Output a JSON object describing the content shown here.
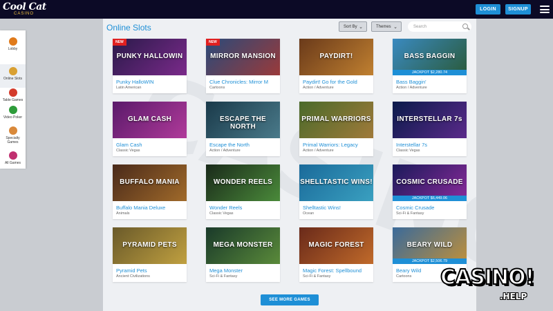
{
  "header": {
    "logo_text": "Cool Cat",
    "logo_sub": "CASINO",
    "login_label": "LOGIN",
    "signup_label": "SIGNUP"
  },
  "sidebar": {
    "items": [
      {
        "label": "Lobby",
        "icon": "lobby-icon",
        "color": "#e07a1a",
        "active": false
      },
      {
        "label": "Online Slots",
        "icon": "slot-machine-icon",
        "color": "#d9a032",
        "active": true
      },
      {
        "label": "Table Games",
        "icon": "roulette-icon",
        "color": "#d43b2b",
        "active": false
      },
      {
        "label": "Video Poker",
        "icon": "playing-card-icon",
        "color": "#2e9c3a",
        "active": false
      },
      {
        "label": "Specialty Games",
        "icon": "specialty-icon",
        "color": "#d9893a",
        "active": false
      },
      {
        "label": "All Games",
        "icon": "all-games-icon",
        "color": "#c03070",
        "active": false
      }
    ]
  },
  "main": {
    "title": "Online Slots",
    "sort_label": "Sort By",
    "themes_label": "Themes",
    "search_placeholder": "Search",
    "see_more_label": "SEE MORE GAMES",
    "games": [
      {
        "name": "Punky HalloWIN",
        "category": "Latin American",
        "new": "NEW",
        "jackpot": "",
        "art": "PUNKY HALLOWIN",
        "c1": "#2a1a4a",
        "c2": "#7a2a8a"
      },
      {
        "name": "Clue Chronicles: Mirror M",
        "category": "Cartoons",
        "new": "NEW",
        "jackpot": "",
        "art": "MIRROR MANSION",
        "c1": "#2a4a7a",
        "c2": "#9a3a3a"
      },
      {
        "name": "Paydirt! Go for the Gold",
        "category": "Action / Adventure",
        "new": "",
        "jackpot": "",
        "art": "PAYDIRT!",
        "c1": "#6a3a1a",
        "c2": "#c08030"
      },
      {
        "name": "Bass Baggin'",
        "category": "Action / Adventure",
        "new": "",
        "jackpot": "JACKPOT $2,280.74",
        "art": "BASS BAGGIN",
        "c1": "#3a8ac0",
        "c2": "#2a5a3a"
      },
      {
        "name": "Glam Cash",
        "category": "Classic Vegas",
        "new": "",
        "jackpot": "",
        "art": "GLAM CASH",
        "c1": "#5a1a6a",
        "c2": "#b03a9a"
      },
      {
        "name": "Escape the North",
        "category": "Action / Adventure",
        "new": "",
        "jackpot": "",
        "art": "ESCAPE THE NORTH",
        "c1": "#1a3a4a",
        "c2": "#4a7a8a"
      },
      {
        "name": "Primal Warriors: Legacy",
        "category": "Action / Adventure",
        "new": "",
        "jackpot": "",
        "art": "PRIMAL WARRIORS",
        "c1": "#4a6a2a",
        "c2": "#a07a3a"
      },
      {
        "name": "Interstellar 7s",
        "category": "Classic Vegas",
        "new": "",
        "jackpot": "",
        "art": "INTERSTELLAR 7s",
        "c1": "#0a1a4a",
        "c2": "#5a2a8a"
      },
      {
        "name": "Buffalo Mania Deluxe",
        "category": "Animals",
        "new": "",
        "jackpot": "",
        "art": "BUFFALO MANIA",
        "c1": "#4a2a1a",
        "c2": "#a06a2a"
      },
      {
        "name": "Wonder Reels",
        "category": "Classic Vegas",
        "new": "",
        "jackpot": "",
        "art": "WONDER REELS",
        "c1": "#1a2a1a",
        "c2": "#4a8a3a"
      },
      {
        "name": "Shelltastic Wins!",
        "category": "Ocean",
        "new": "",
        "jackpot": "",
        "art": "SHELLTASTIC WINS!",
        "c1": "#1a6a9a",
        "c2": "#3aa0c0"
      },
      {
        "name": "Cosmic Crusade",
        "category": "Sci-Fi & Fantasy",
        "new": "",
        "jackpot": "JACKPOT $6,449.06",
        "art": "COSMIC CRUSADE",
        "c1": "#1a1a5a",
        "c2": "#8a2a9a"
      },
      {
        "name": "Pyramid Pets",
        "category": "Ancient Civilizations",
        "new": "",
        "jackpot": "",
        "art": "PYRAMID PETS",
        "c1": "#6a5a2a",
        "c2": "#c0a040"
      },
      {
        "name": "Mega Monster",
        "category": "Sci-Fi & Fantasy",
        "new": "",
        "jackpot": "",
        "art": "MEGA MONSTER",
        "c1": "#1a3a2a",
        "c2": "#5a8a3a"
      },
      {
        "name": "Magic Forest: Spellbound",
        "category": "Sci-Fi & Fantasy",
        "new": "",
        "jackpot": "",
        "art": "MAGIC FOREST",
        "c1": "#6a2a1a",
        "c2": "#c06a2a"
      },
      {
        "name": "Beary Wild",
        "category": "Cartoons",
        "new": "",
        "jackpot": "JACKPOT $2,506.79",
        "art": "BEARY WILD",
        "c1": "#3a6a9a",
        "c2": "#c0903a"
      }
    ]
  },
  "watermark": {
    "main": "CASINO!",
    "sub": ".HELP"
  }
}
